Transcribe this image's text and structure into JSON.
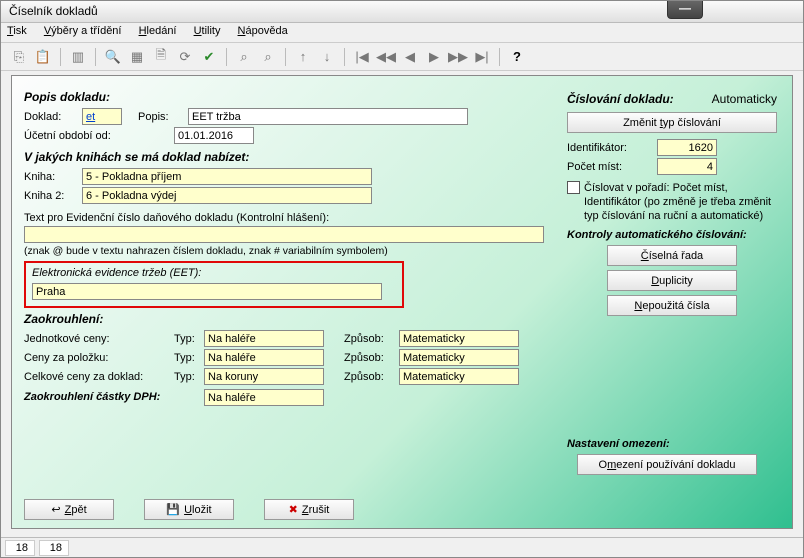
{
  "window": {
    "title": "Číselník dokladů"
  },
  "menu": {
    "tisk": "Tisk",
    "vybery": "Výběry a třídění",
    "hledani": "Hledání",
    "utility": "Utility",
    "napoveda": "Nápověda"
  },
  "popis": {
    "heading": "Popis dokladu:",
    "doklad_lbl": "Doklad:",
    "doklad_val": "et",
    "popis_lbl": "Popis:",
    "popis_val": "EET tržba",
    "obdobi_lbl": "Účetní období od:",
    "obdobi_val": "01.01.2016"
  },
  "knihy": {
    "heading": "V jakých knihách se má doklad nabízet:",
    "kniha_lbl": "Kniha:",
    "kniha_val": "5 - Pokladna příjem",
    "kniha2_lbl": "Kniha 2:",
    "kniha2_val": "6 - Pokladna výdej"
  },
  "evid": {
    "text_lbl": "Text pro Evidenční číslo daňového dokladu (Kontrolní hlášení):",
    "text_val": "",
    "hint": "(znak @ bude v textu nahrazen číslem dokladu, znak # variabilním symbolem)"
  },
  "eet": {
    "heading": "Elektronická evidence tržeb (EET):",
    "val": "Praha"
  },
  "zaokr": {
    "heading": "Zaokrouhlení:",
    "jedn_lbl": "Jednotkové ceny:",
    "pol_lbl": "Ceny za položku:",
    "celk_lbl": "Celkové ceny za doklad:",
    "typ_lbl": "Typ:",
    "zp_lbl": "Způsob:",
    "na_halere": "Na haléře",
    "na_koruny": "Na koruny",
    "matematicky": "Matematicky",
    "dph_heading": "Zaokrouhlení částky DPH:"
  },
  "cislovani": {
    "heading": "Číslování dokladu:",
    "mode": "Automaticky",
    "zmenit_btn": "Změnit typ číslování",
    "identif_lbl": "Identifikátor:",
    "identif_val": "1620",
    "pocet_lbl": "Počet míst:",
    "pocet_val": "4",
    "cislovat_lbl": "Číslovat v pořadí: Počet míst, Identifikátor (po změně je třeba změnit typ číslování na ruční a automatické)",
    "kontroly_heading": "Kontroly automatického číslování:",
    "rada_btn": "Číselná řada",
    "dup_btn": "Duplicity",
    "neuz_btn": "Nepoužitá čísla"
  },
  "omezeni": {
    "heading": "Nastavení omezení:",
    "btn": "Omezení používání dokladu"
  },
  "buttons": {
    "zpet": "Zpět",
    "ulozit": "Uložit",
    "zrusit": "Zrušit"
  },
  "status": {
    "a": "18",
    "b": "18"
  }
}
